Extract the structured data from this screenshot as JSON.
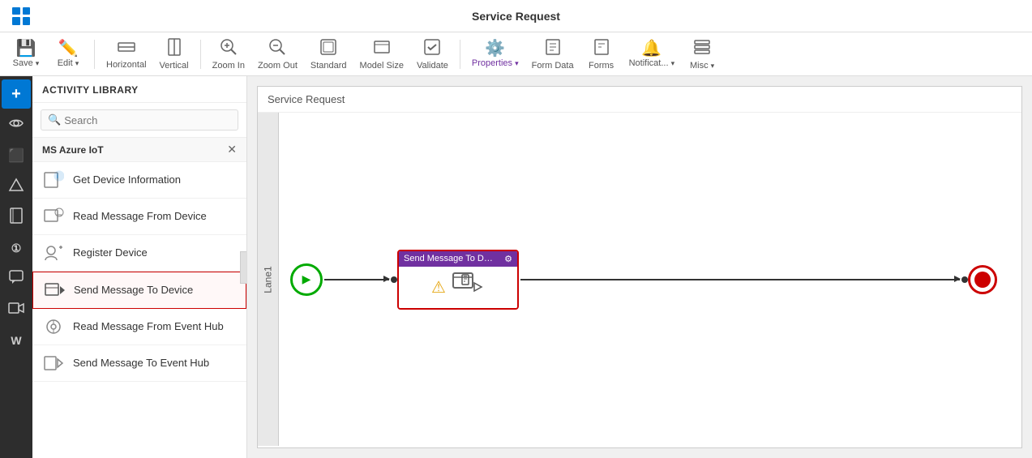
{
  "topbar": {
    "title": "Service Request"
  },
  "toolbar": {
    "buttons": [
      {
        "id": "save",
        "label": "Save",
        "icon": "💾",
        "has_arrow": true
      },
      {
        "id": "edit",
        "label": "Edit",
        "icon": "✏️",
        "has_arrow": true
      },
      {
        "id": "horizontal",
        "label": "Horizontal",
        "icon": "⬜",
        "has_arrow": false
      },
      {
        "id": "vertical",
        "label": "Vertical",
        "icon": "▭",
        "has_arrow": false
      },
      {
        "id": "zoom-in",
        "label": "Zoom In",
        "icon": "🔍",
        "has_arrow": false
      },
      {
        "id": "zoom-out",
        "label": "Zoom Out",
        "icon": "🔎",
        "has_arrow": false
      },
      {
        "id": "standard",
        "label": "Standard",
        "icon": "⊡",
        "has_arrow": false
      },
      {
        "id": "model-size",
        "label": "Model Size",
        "icon": "⬡",
        "has_arrow": false
      },
      {
        "id": "validate",
        "label": "Validate",
        "icon": "☑",
        "has_arrow": false
      },
      {
        "id": "properties",
        "label": "Properties",
        "icon": "⚙️",
        "has_arrow": true,
        "active": true
      },
      {
        "id": "form-data",
        "label": "Form Data",
        "icon": "🗃",
        "has_arrow": false
      },
      {
        "id": "forms",
        "label": "Forms",
        "icon": "📄",
        "has_arrow": false
      },
      {
        "id": "notifications",
        "label": "Notificat...",
        "icon": "🔔",
        "has_arrow": true
      },
      {
        "id": "misc",
        "label": "Misc",
        "icon": "🗂",
        "has_arrow": true
      }
    ]
  },
  "sidebar": {
    "icons": [
      {
        "id": "add",
        "icon": "+",
        "active_blue": true
      },
      {
        "id": "eye",
        "icon": "👁"
      },
      {
        "id": "office",
        "icon": "⬛"
      },
      {
        "id": "drive",
        "icon": "△"
      },
      {
        "id": "notebook",
        "icon": "📓"
      },
      {
        "id": "number",
        "icon": "①"
      },
      {
        "id": "chat",
        "icon": "💬"
      },
      {
        "id": "video",
        "icon": "📷"
      },
      {
        "id": "wp",
        "icon": "W"
      }
    ]
  },
  "activity_library": {
    "title": "ACTIVITY LIBRARY",
    "search_placeholder": "Search",
    "category": "MS Azure IoT",
    "items": [
      {
        "id": "get-device-info",
        "label": "Get Device Information",
        "selected": false
      },
      {
        "id": "read-msg-device",
        "label": "Read Message From Device",
        "selected": false
      },
      {
        "id": "register-device",
        "label": "Register Device",
        "selected": false
      },
      {
        "id": "send-msg-device",
        "label": "Send Message To Device",
        "selected": true
      },
      {
        "id": "read-msg-eventhub",
        "label": "Read Message From Event Hub",
        "selected": false
      },
      {
        "id": "send-msg-eventhub",
        "label": "Send Message To Event Hub",
        "selected": false
      }
    ]
  },
  "canvas": {
    "breadcrumb": "Service Request",
    "lane_label": "Lane1",
    "flow_node": {
      "title": "Send Message To Devi...",
      "has_warning": true
    }
  }
}
